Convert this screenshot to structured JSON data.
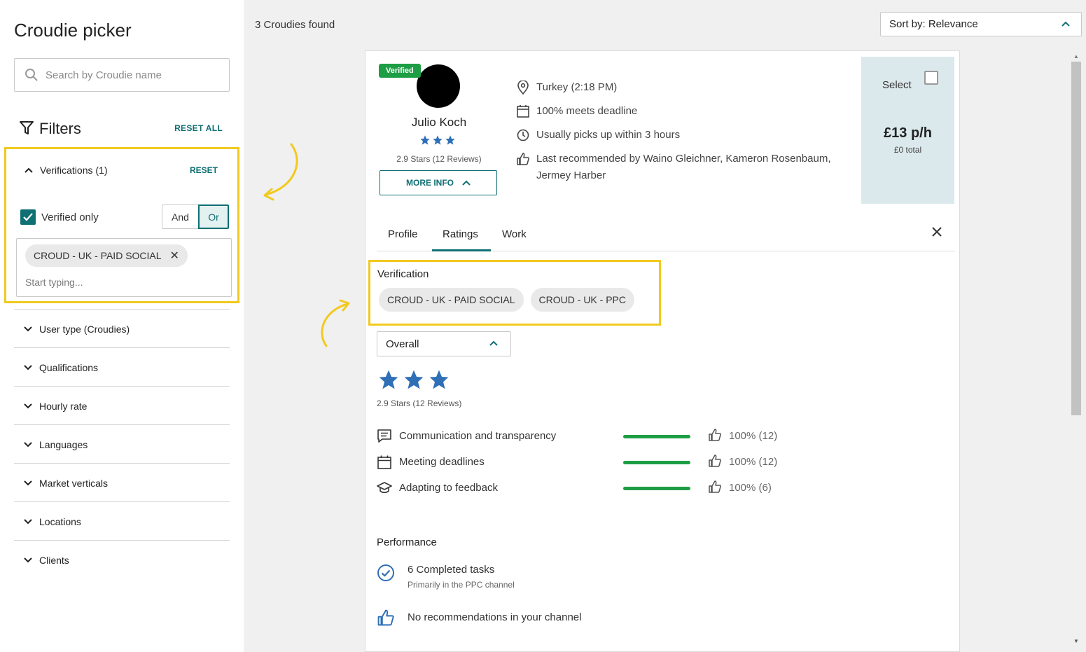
{
  "app": {
    "title": "Croudie picker"
  },
  "search": {
    "placeholder": "Search by Croudie name"
  },
  "filters": {
    "title": "Filters",
    "reset_all": "RESET ALL",
    "verifications": {
      "label": "Verifications (1)",
      "reset": "RESET",
      "checkbox_label": "Verified only",
      "checkbox_checked": true,
      "toggle_and": "And",
      "toggle_or": "Or",
      "selected_toggle": "Or",
      "chips": [
        "CROUD - UK - PAID SOCIAL"
      ],
      "input_placeholder": "Start typing..."
    },
    "sections": [
      "User type (Croudies)",
      "Qualifications",
      "Hourly rate",
      "Languages",
      "Market verticals",
      "Locations",
      "Clients"
    ]
  },
  "results": {
    "count_text": "3 Croudies found",
    "sort_label": "Sort by: Relevance"
  },
  "card": {
    "badge": "Verified",
    "name": "Julio Koch",
    "stars": 3,
    "rating_text": "2.9 Stars (12 Reviews)",
    "more_info": "MORE INFO",
    "info": {
      "location": "Turkey (2:18 PM)",
      "deadline": "100% meets deadline",
      "pickup": "Usually picks up within 3 hours",
      "recommended": "Last recommended by Waino Gleichner, Kameron Rosenbaum, Jermey Harber"
    },
    "select_label": "Select",
    "price": "£13 p/h",
    "price_total": "£0 total",
    "tabs": [
      "Profile",
      "Ratings",
      "Work"
    ],
    "active_tab": "Ratings",
    "verification": {
      "title": "Verification",
      "chips": [
        "CROUD - UK - PAID SOCIAL",
        "CROUD - UK - PPC"
      ]
    },
    "overall_select": "Overall",
    "overall_stars": 3,
    "overall_rating_text": "2.9 Stars (12 Reviews)",
    "criteria": [
      {
        "label": "Communication and transparency",
        "value": "100% (12)",
        "percent": 100,
        "icon": "chat-icon"
      },
      {
        "label": "Meeting deadlines",
        "value": "100% (12)",
        "percent": 100,
        "icon": "calendar-icon"
      },
      {
        "label": "Adapting to feedback",
        "value": "100% (6)",
        "percent": 100,
        "icon": "graduation-cap-icon"
      }
    ],
    "performance": {
      "title": "Performance",
      "completed": "6 Completed tasks",
      "completed_sub": "Primarily in the PPC channel",
      "recommendations": "No recommendations in your channel"
    }
  },
  "colors": {
    "teal": "#0f6f74",
    "green": "#1e9e44",
    "star_blue": "#2f6fb6",
    "highlight_yellow": "#f2c91f",
    "select_panel_bg": "#dce9ec"
  }
}
